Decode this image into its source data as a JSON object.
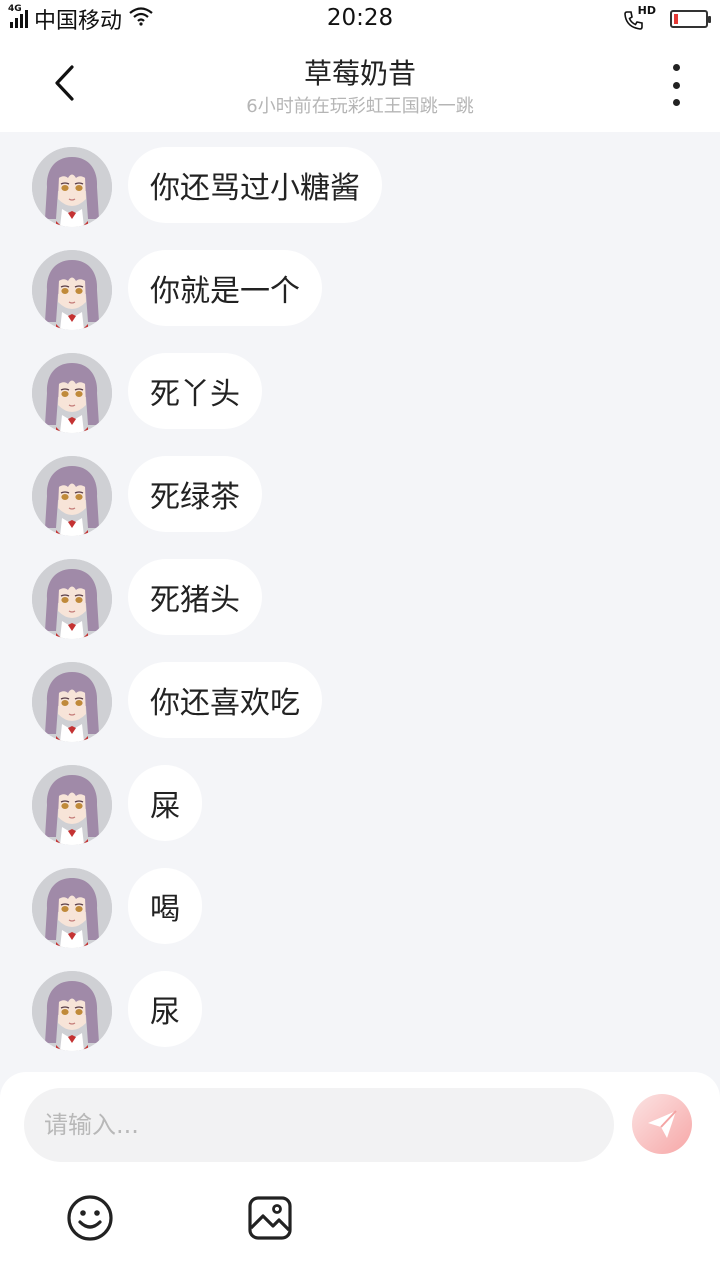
{
  "status_bar": {
    "network_tag": "4G",
    "carrier": "中国移动",
    "time": "20:28",
    "call_tag": "HD",
    "battery_level": 0.12
  },
  "header": {
    "title": "草莓奶昔",
    "subtitle": "6小时前在玩彩虹王国跳一跳"
  },
  "messages": [
    {
      "text": "你还骂过小糖酱"
    },
    {
      "text": "你就是一个"
    },
    {
      "text": "死丫头"
    },
    {
      "text": "死绿茶"
    },
    {
      "text": "死猪头"
    },
    {
      "text": "你还喜欢吃"
    },
    {
      "text": "屎"
    },
    {
      "text": "喝"
    },
    {
      "text": "尿"
    }
  ],
  "composer": {
    "placeholder": "请输入..."
  },
  "colors": {
    "send_button": "#f7a7a7",
    "avatar_hair": "#a08aa8",
    "background": "#f4f5f8"
  }
}
